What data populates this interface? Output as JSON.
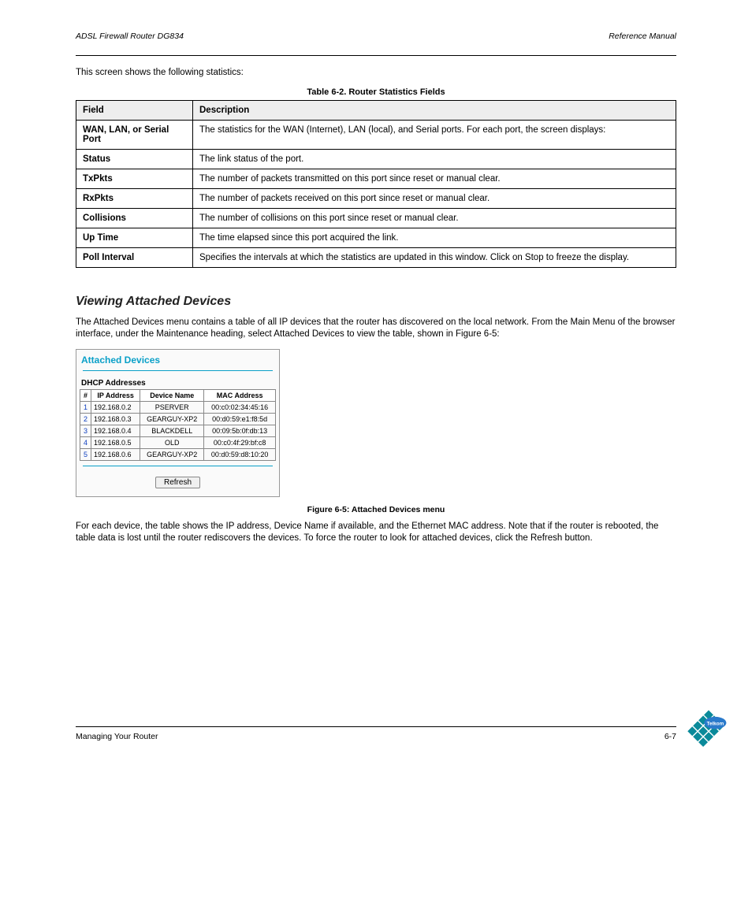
{
  "header": {
    "left": "ADSL Firewall Router DG834",
    "right": "Reference Manual"
  },
  "intro_text": "This screen shows the following statistics:",
  "stats_table": {
    "caption": "Table 6-2. Router Statistics Fields",
    "headers": [
      "Field",
      "Description"
    ],
    "rows": [
      {
        "field": "WAN, LAN, or Serial Port",
        "desc": "The statistics for the WAN (Internet), LAN (local), and Serial ports. For each port, the screen displays:"
      },
      {
        "field": "Status",
        "desc": "The link status of the port."
      },
      {
        "field": "TxPkts",
        "desc": "The number of packets transmitted on this port since reset or manual clear."
      },
      {
        "field": "RxPkts",
        "desc": "The number of packets received on this port since reset or manual clear."
      },
      {
        "field": "Collisions",
        "desc": "The number of collisions on this port since reset or manual clear."
      },
      {
        "field": "Up Time",
        "desc": "The time elapsed since this port acquired the link."
      },
      {
        "field": "Poll Interval",
        "desc": "Specifies the intervals at which the statistics are updated in this window. Click on Stop to freeze the display."
      }
    ]
  },
  "section_heading": "Viewing Attached Devices",
  "para1": "The Attached Devices menu contains a table of all IP devices that the router has discovered on the local network. From the Main Menu of the browser interface, under the Maintenance heading, select Attached Devices to view the table, shown in Figure 6-5:",
  "attached_panel": {
    "title": "Attached Devices",
    "subtitle": "DHCP Addresses",
    "headers": [
      "#",
      "IP Address",
      "Device Name",
      "MAC Address"
    ],
    "rows": [
      {
        "n": "1",
        "ip": "192.168.0.2",
        "name": "PSERVER",
        "mac": "00:c0:02:34:45:16"
      },
      {
        "n": "2",
        "ip": "192.168.0.3",
        "name": "GEARGUY-XP2",
        "mac": "00:d0:59:e1:f8:5d"
      },
      {
        "n": "3",
        "ip": "192.168.0.4",
        "name": "BLACKDELL",
        "mac": "00:09:5b:0f:db:13"
      },
      {
        "n": "4",
        "ip": "192.168.0.5",
        "name": "OLD",
        "mac": "00:c0:4f:29:bf:c8"
      },
      {
        "n": "5",
        "ip": "192.168.0.6",
        "name": "GEARGUY-XP2",
        "mac": "00:d0:59:d8:10:20"
      }
    ],
    "refresh_label": "Refresh"
  },
  "fig_caption": "Figure 6-5: Attached Devices menu",
  "para2": "For each device, the table shows the IP address, Device Name if available, and the Ethernet MAC address. Note that if the router is rebooted, the table data is lost until the router rediscovers the devices. To force the router to look for attached devices, click the Refresh button.",
  "footer": {
    "left": "Managing Your Router",
    "right": "6-7"
  }
}
